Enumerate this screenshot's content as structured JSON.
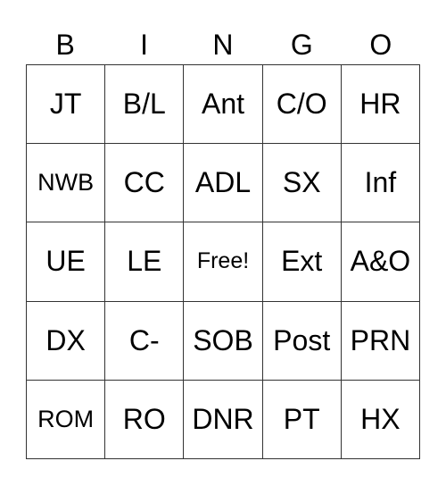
{
  "header": [
    "B",
    "I",
    "N",
    "G",
    "O"
  ],
  "rows": [
    [
      "JT",
      "B/L",
      "Ant",
      "C/O",
      "HR"
    ],
    [
      "NWB",
      "CC",
      "ADL",
      "SX",
      "Inf"
    ],
    [
      "UE",
      "LE",
      "Free!",
      "Ext",
      "A&O"
    ],
    [
      "DX",
      "C-",
      "SOB",
      "Post",
      "PRN"
    ],
    [
      "ROM",
      "RO",
      "DNR",
      "PT",
      "HX"
    ]
  ]
}
